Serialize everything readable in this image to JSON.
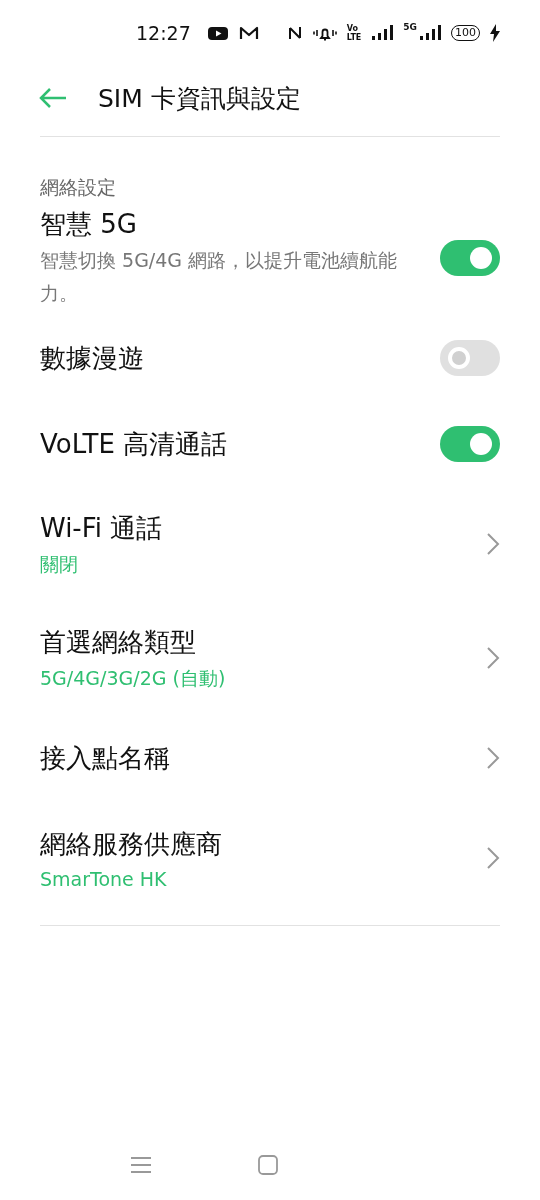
{
  "status_bar": {
    "time": "12:27",
    "volte_top": "Vo",
    "volte_bottom": "LTE",
    "network": "5G",
    "battery": "100"
  },
  "app_bar": {
    "title": "SIM 卡資訊與設定"
  },
  "section": {
    "title": "網絡設定"
  },
  "items": [
    {
      "kind": "toggle",
      "title": "智慧 5G",
      "subtitle": "智慧切換 5G/4G 網路，以提升電池續航能力。",
      "on": true
    },
    {
      "kind": "toggle",
      "title": "數據漫遊",
      "on": false
    },
    {
      "kind": "toggle",
      "title": "VoLTE 高清通話",
      "on": true
    },
    {
      "kind": "link",
      "title": "Wi-Fi 通話",
      "value": "關閉"
    },
    {
      "kind": "link",
      "title": "首選網絡類型",
      "value": "5G/4G/3G/2G (自動)"
    },
    {
      "kind": "link",
      "title": "接入點名稱"
    },
    {
      "kind": "link",
      "title": "網絡服務供應商",
      "value": "SmarTone HK"
    }
  ]
}
